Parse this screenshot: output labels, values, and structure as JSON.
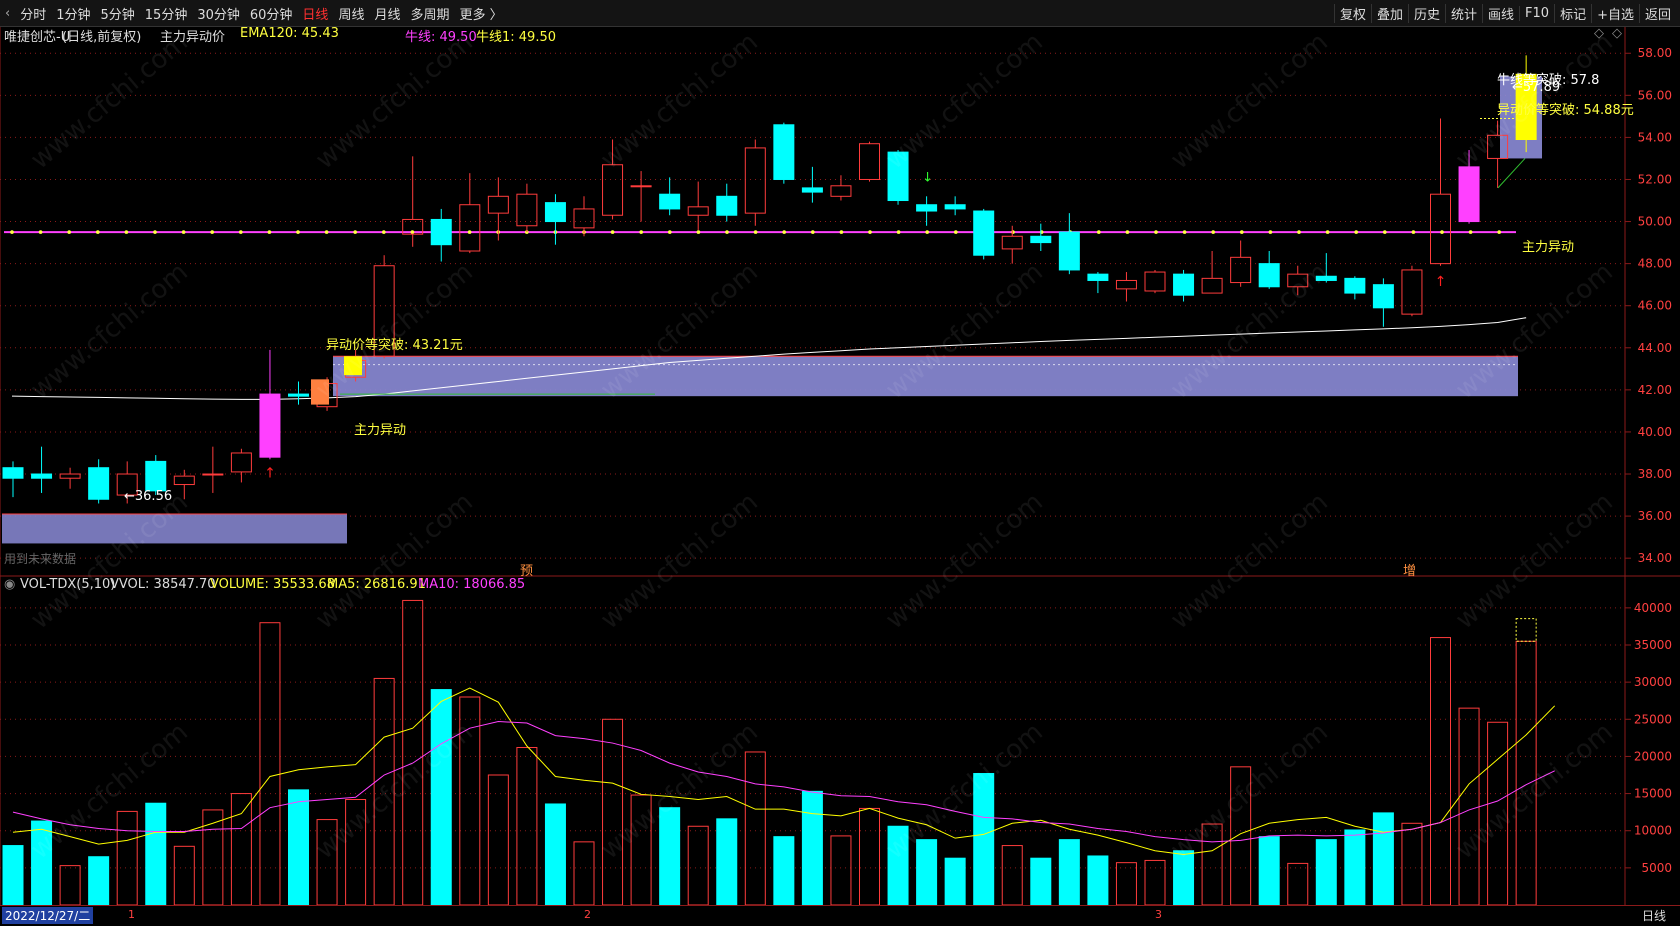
{
  "toolbar": {
    "period_tabs": [
      "分时",
      "1分钟",
      "5分钟",
      "15分钟",
      "30分钟",
      "60分钟",
      "日线",
      "周线",
      "月线",
      "多周期",
      "更多 〉"
    ],
    "active_tab": "日线",
    "right_buttons": [
      "复权",
      "叠加",
      "历史",
      "统计",
      "画线",
      "F10",
      "标记",
      "+自选",
      "返回"
    ]
  },
  "header": {
    "stock": "唯捷创芯-U",
    "mode": "(日线,前复权)",
    "indicator_name": "主力异动价",
    "ema_label": "EMA120: 45.43",
    "niu_label": "牛线: 49.50",
    "niu1_label": "牛线1: 49.50"
  },
  "volume_header": {
    "name": "VOL-TDX(5,10)",
    "vvol": "VVOL: 38547.70",
    "volume": "VOLUME: 35533.68",
    "ma5": "MA5: 26816.91",
    "ma10": "MA10: 18066.85"
  },
  "annotations": {
    "low_price": "←36.56",
    "break_left": "异动价等突破: 43.21元",
    "zhuli_left": "主力异动",
    "zhuli_right": "主力异动",
    "niu_break": "牛线等突破: 57.8",
    "high_price": "←57.89",
    "break_right": "异动价等突破: 54.88元",
    "left_box_text": "用到未来数据",
    "marker_yu": "预",
    "marker_zeng": "增"
  },
  "statusbar": {
    "date": "2022/12/27/二",
    "month_marks": [
      "1",
      "2",
      "3"
    ],
    "period": "日线"
  },
  "colors": {
    "up": "#ff3c3c",
    "down": "#00ffff",
    "ema": "#ffffff",
    "niu": "#ff40ff",
    "ma5": "#ffff00",
    "ma10": "#ff40ff",
    "zone": "#8c8cd8",
    "grid": "#8b1a1a",
    "axis_text": "#ff4040"
  },
  "chart_data": {
    "type": "candlestick",
    "price_axis": {
      "ticks": [
        34,
        36,
        38,
        40,
        42,
        44,
        46,
        48,
        50,
        52,
        54,
        56,
        58
      ],
      "range": [
        33.2,
        59.2
      ]
    },
    "volume_axis": {
      "ticks": [
        5000,
        10000,
        15000,
        20000,
        25000,
        30000,
        35000,
        40000
      ],
      "range": [
        0,
        42000
      ]
    },
    "candles": [
      {
        "o": 38.3,
        "c": 37.8,
        "h": 38.6,
        "l": 36.9,
        "v": 8000
      },
      {
        "o": 38.0,
        "c": 37.8,
        "h": 39.3,
        "l": 37.1,
        "v": 11300
      },
      {
        "o": 37.8,
        "c": 38.0,
        "h": 38.3,
        "l": 37.3,
        "v": 5300
      },
      {
        "o": 38.3,
        "c": 36.8,
        "h": 38.7,
        "l": 36.6,
        "v": 6500
      },
      {
        "o": 37.0,
        "c": 38.0,
        "h": 38.6,
        "l": 36.6,
        "v": 12600
      },
      {
        "o": 38.6,
        "c": 37.2,
        "h": 38.9,
        "l": 37.0,
        "v": 13700
      },
      {
        "o": 37.5,
        "c": 37.9,
        "h": 38.2,
        "l": 36.8,
        "v": 7900
      },
      {
        "o": 38.0,
        "c": 38.0,
        "h": 39.3,
        "l": 37.1,
        "v": 12800
      },
      {
        "o": 38.1,
        "c": 39.0,
        "h": 39.2,
        "l": 37.6,
        "v": 15000
      },
      {
        "o": 38.8,
        "c": 41.8,
        "h": 43.9,
        "l": 38.7,
        "v": 38000
      },
      {
        "o": 41.8,
        "c": 41.7,
        "h": 42.4,
        "l": 41.3,
        "v": 15500
      },
      {
        "o": 41.2,
        "c": 42.3,
        "h": 42.6,
        "l": 41.0,
        "v": 11500
      },
      {
        "o": 42.6,
        "c": 43.4,
        "h": 43.9,
        "l": 42.4,
        "v": 14200
      },
      {
        "o": 43.6,
        "c": 47.9,
        "h": 48.4,
        "l": 43.5,
        "v": 30500
      },
      {
        "o": 49.4,
        "c": 50.1,
        "h": 53.1,
        "l": 48.8,
        "v": 41000
      },
      {
        "o": 50.1,
        "c": 48.9,
        "h": 50.6,
        "l": 48.1,
        "v": 29000
      },
      {
        "o": 48.6,
        "c": 50.8,
        "h": 52.3,
        "l": 48.5,
        "v": 28000
      },
      {
        "o": 50.4,
        "c": 51.2,
        "h": 52.1,
        "l": 49.1,
        "v": 17500
      },
      {
        "o": 49.8,
        "c": 51.3,
        "h": 51.8,
        "l": 49.5,
        "v": 21200
      },
      {
        "o": 50.9,
        "c": 50.0,
        "h": 51.3,
        "l": 48.9,
        "v": 13600
      },
      {
        "o": 49.7,
        "c": 50.6,
        "h": 51.2,
        "l": 49.3,
        "v": 8500
      },
      {
        "o": 50.3,
        "c": 52.7,
        "h": 53.9,
        "l": 50.1,
        "v": 25000
      },
      {
        "o": 51.7,
        "c": 51.7,
        "h": 52.4,
        "l": 50.0,
        "v": 14800
      },
      {
        "o": 51.3,
        "c": 50.6,
        "h": 52.1,
        "l": 50.3,
        "v": 13100
      },
      {
        "o": 50.3,
        "c": 50.7,
        "h": 51.9,
        "l": 49.6,
        "v": 10600
      },
      {
        "o": 51.2,
        "c": 50.3,
        "h": 51.8,
        "l": 50.0,
        "v": 11600
      },
      {
        "o": 50.4,
        "c": 53.5,
        "h": 53.9,
        "l": 49.8,
        "v": 20600
      },
      {
        "o": 54.6,
        "c": 52.0,
        "h": 54.7,
        "l": 51.8,
        "v": 9200
      },
      {
        "o": 51.6,
        "c": 51.4,
        "h": 52.6,
        "l": 50.9,
        "v": 15300
      },
      {
        "o": 51.2,
        "c": 51.7,
        "h": 52.2,
        "l": 51.0,
        "v": 9300
      },
      {
        "o": 52.0,
        "c": 53.7,
        "h": 53.8,
        "l": 51.9,
        "v": 13000
      },
      {
        "o": 53.3,
        "c": 51.0,
        "h": 53.4,
        "l": 50.8,
        "v": 10600
      },
      {
        "o": 50.8,
        "c": 50.5,
        "h": 51.2,
        "l": 49.8,
        "v": 8800
      },
      {
        "o": 50.8,
        "c": 50.6,
        "h": 51.2,
        "l": 50.3,
        "v": 6300
      },
      {
        "o": 50.5,
        "c": 48.4,
        "h": 50.6,
        "l": 48.2,
        "v": 17700
      },
      {
        "o": 48.7,
        "c": 49.3,
        "h": 49.8,
        "l": 48.0,
        "v": 8000
      },
      {
        "o": 49.3,
        "c": 49.0,
        "h": 49.9,
        "l": 48.6,
        "v": 6300
      },
      {
        "o": 49.5,
        "c": 47.7,
        "h": 50.4,
        "l": 47.5,
        "v": 8800
      },
      {
        "o": 47.5,
        "c": 47.2,
        "h": 47.6,
        "l": 46.6,
        "v": 6600
      },
      {
        "o": 46.8,
        "c": 47.2,
        "h": 47.6,
        "l": 46.2,
        "v": 5700
      },
      {
        "o": 46.7,
        "c": 47.6,
        "h": 47.7,
        "l": 46.6,
        "v": 6000
      },
      {
        "o": 47.5,
        "c": 46.5,
        "h": 47.7,
        "l": 46.2,
        "v": 7300
      },
      {
        "o": 46.6,
        "c": 47.3,
        "h": 48.6,
        "l": 46.6,
        "v": 10900
      },
      {
        "o": 47.1,
        "c": 48.3,
        "h": 49.1,
        "l": 46.9,
        "v": 18600
      },
      {
        "o": 48.0,
        "c": 46.9,
        "h": 48.6,
        "l": 46.8,
        "v": 9200
      },
      {
        "o": 46.9,
        "c": 47.5,
        "h": 47.9,
        "l": 46.5,
        "v": 5600
      },
      {
        "o": 47.4,
        "c": 47.2,
        "h": 48.5,
        "l": 47.1,
        "v": 8800
      },
      {
        "o": 47.3,
        "c": 46.6,
        "h": 47.4,
        "l": 46.3,
        "v": 10100
      },
      {
        "o": 47.0,
        "c": 45.9,
        "h": 47.3,
        "l": 45.0,
        "v": 12400
      },
      {
        "o": 45.6,
        "c": 47.7,
        "h": 47.9,
        "l": 45.5,
        "v": 11000
      },
      {
        "o": 48.0,
        "c": 51.3,
        "h": 54.9,
        "l": 47.9,
        "v": 36000
      },
      {
        "o": 50.0,
        "c": 52.6,
        "h": 53.4,
        "l": 49.9,
        "v": 26500
      },
      {
        "o": 53.0,
        "c": 54.1,
        "h": 54.8,
        "l": 51.6,
        "v": 24600
      },
      {
        "o": 53.9,
        "c": 57.0,
        "h": 57.9,
        "l": 53.3,
        "v": 35500
      }
    ],
    "ema120": [
      41.7,
      41.68,
      41.66,
      41.64,
      41.62,
      41.6,
      41.58,
      41.56,
      41.55,
      41.55,
      41.58,
      41.62,
      41.68,
      41.8,
      41.95,
      42.1,
      42.25,
      42.4,
      42.55,
      42.7,
      42.85,
      43.0,
      43.15,
      43.3,
      43.4,
      43.5,
      43.6,
      43.7,
      43.78,
      43.86,
      43.94,
      44.0,
      44.06,
      44.12,
      44.18,
      44.24,
      44.3,
      44.35,
      44.4,
      44.45,
      44.5,
      44.55,
      44.6,
      44.65,
      44.7,
      44.75,
      44.8,
      44.85,
      44.9,
      44.95,
      45.02,
      45.1,
      45.2,
      45.43
    ],
    "niu_line": 49.5,
    "ma5": [
      9800,
      10200,
      9200,
      8200,
      8700,
      9800,
      9800,
      11000,
      12300,
      17300,
      18200,
      18600,
      18900,
      22600,
      23800,
      27400,
      29200,
      27300,
      21400,
      17300,
      16800,
      16400,
      14900,
      14600,
      14200,
      14600,
      12900,
      12900,
      12300,
      12000,
      13000,
      11700,
      10800,
      9000,
      9500,
      11000,
      11400,
      10200,
      9400,
      8400,
      7300,
      6800,
      7300,
      9600,
      11000,
      11500,
      11800,
      10600,
      9800,
      10200,
      11100,
      16300,
      19600,
      22900,
      26817
    ],
    "ma10": [
      12500,
      11600,
      10800,
      10300,
      10000,
      9900,
      9900,
      10200,
      10300,
      13100,
      13900,
      14200,
      14500,
      17500,
      19100,
      21700,
      23800,
      24700,
      24500,
      22800,
      22400,
      21800,
      20800,
      19100,
      17900,
      17300,
      16300,
      15900,
      15200,
      14700,
      14600,
      13900,
      13500,
      12600,
      11800,
      11600,
      11100,
      10900,
      10300,
      9900,
      9200,
      8800,
      8500,
      8700,
      9300,
      9400,
      9300,
      9400,
      9700,
      10200,
      11100,
      12800,
      14000,
      16200,
      18067
    ]
  }
}
